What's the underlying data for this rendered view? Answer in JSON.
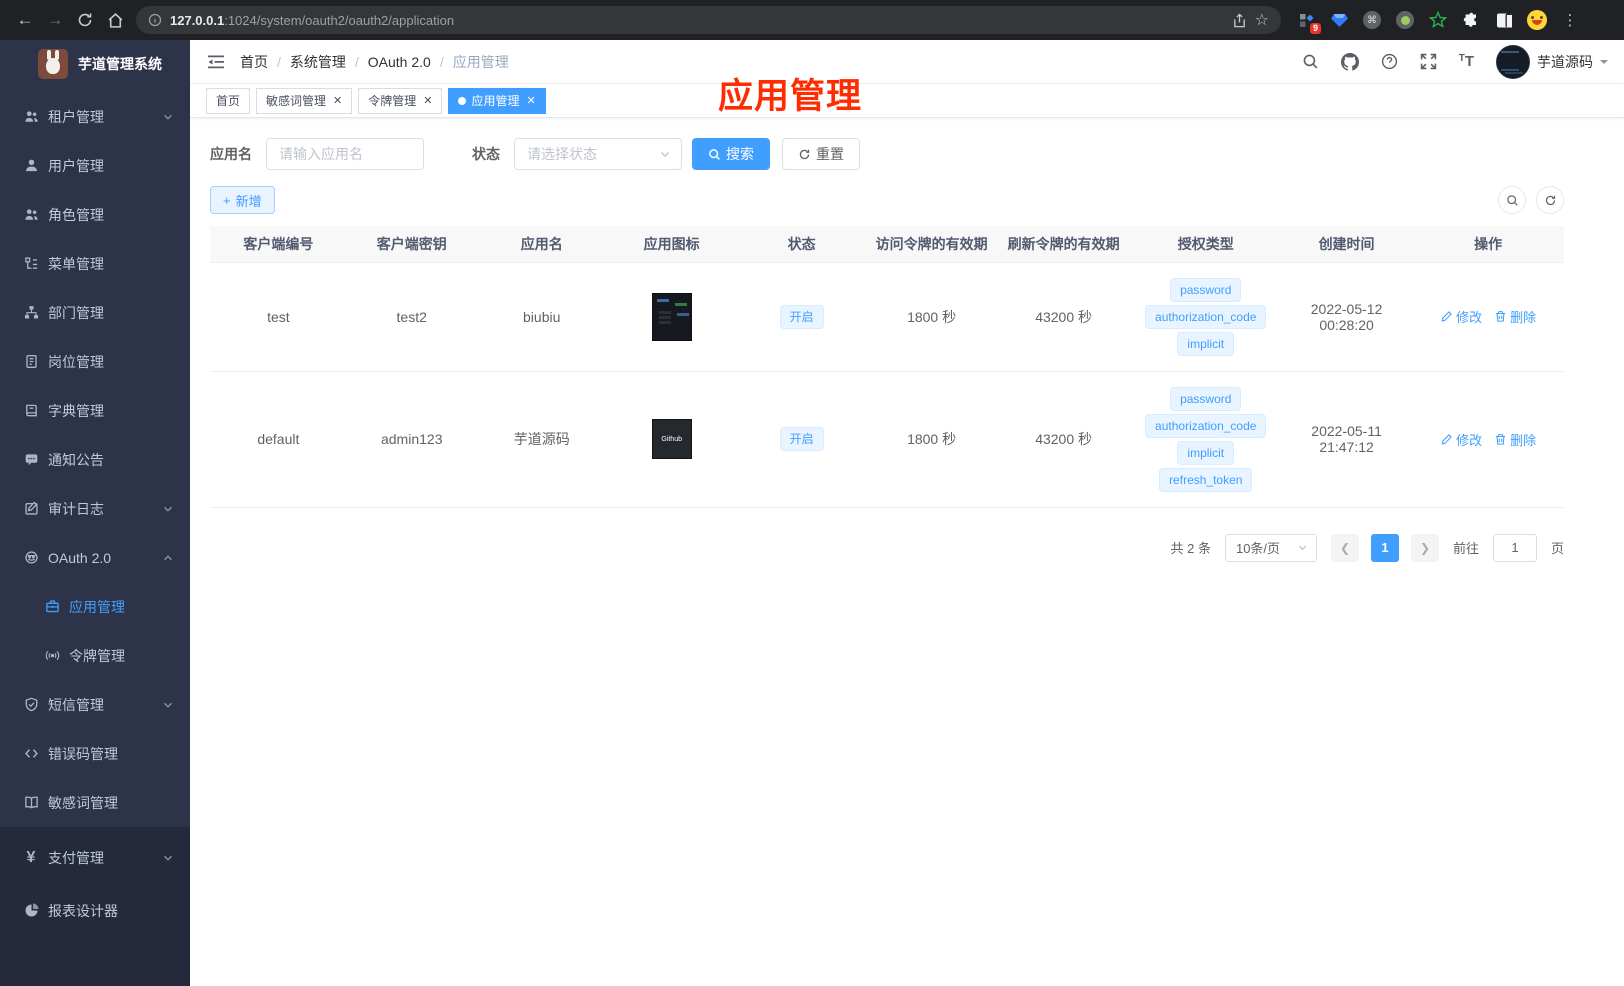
{
  "browser": {
    "url": {
      "host": "127.0.0.1",
      "rest": ":1024/system/oauth2/oauth2/application"
    },
    "ext_badge": "9"
  },
  "sidebar": {
    "app_title": "芋道管理系统",
    "menu": [
      {
        "label": "租户管理",
        "icon": "tenant",
        "arrow": "down"
      },
      {
        "label": "用户管理",
        "icon": "user"
      },
      {
        "label": "角色管理",
        "icon": "role"
      },
      {
        "label": "菜单管理",
        "icon": "menu"
      },
      {
        "label": "部门管理",
        "icon": "dept"
      },
      {
        "label": "岗位管理",
        "icon": "post"
      },
      {
        "label": "字典管理",
        "icon": "dict"
      },
      {
        "label": "通知公告",
        "icon": "notice"
      },
      {
        "label": "审计日志",
        "icon": "log",
        "arrow": "down"
      },
      {
        "label": "OAuth 2.0",
        "icon": "oauth",
        "arrow": "up",
        "children": [
          {
            "label": "应用管理",
            "icon": "app",
            "active": true
          },
          {
            "label": "令牌管理",
            "icon": "token"
          }
        ]
      },
      {
        "label": "短信管理",
        "icon": "sms",
        "arrow": "down"
      },
      {
        "label": "错误码管理",
        "icon": "errcode"
      },
      {
        "label": "敏感词管理",
        "icon": "sensitive"
      }
    ],
    "bottom_menu": [
      {
        "label": "支付管理",
        "icon": "pay",
        "arrow": "down"
      },
      {
        "label": "报表设计器",
        "icon": "report"
      }
    ]
  },
  "navbar": {
    "breadcrumb": [
      "首页",
      "系统管理",
      "OAuth 2.0",
      "应用管理"
    ],
    "username": "芋道源码"
  },
  "annotation": {
    "text": "应用管理",
    "color": "#fe2c00"
  },
  "tags_view": [
    {
      "label": "首页",
      "closable": false,
      "active": false
    },
    {
      "label": "敏感词管理",
      "closable": true,
      "active": false
    },
    {
      "label": "令牌管理",
      "closable": true,
      "active": false
    },
    {
      "label": "应用管理",
      "closable": true,
      "active": true
    }
  ],
  "filter": {
    "name_label": "应用名",
    "name_placeholder": "请输入应用名",
    "status_label": "状态",
    "status_placeholder": "请选择状态",
    "search_label": "搜索",
    "reset_label": "重置"
  },
  "toolbar": {
    "add_label": "新增"
  },
  "table": {
    "columns": [
      "客户端编号",
      "客户端密钥",
      "应用名",
      "应用图标",
      "状态",
      "访问令牌的有效期",
      "刷新令牌的有效期",
      "授权类型",
      "创建时间",
      "操作"
    ],
    "col_widths": [
      "10.1%",
      "9.6%",
      "9.6%",
      "9.6%",
      "9.6%",
      "9.6%",
      "9.9%",
      "11.1%",
      "9.7%",
      "11.2%"
    ],
    "actions": {
      "edit": "修改",
      "delete": "删除"
    },
    "rows": [
      {
        "client_id": "test",
        "secret": "test2",
        "name": "biubiu",
        "icon": "screenshot-thumb",
        "icon_text": "",
        "status": "开启",
        "access_ttl": "1800 秒",
        "refresh_ttl": "43200 秒",
        "grants": [
          "password",
          "authorization_code",
          "implicit"
        ],
        "created": "2022-05-12 00:28:20"
      },
      {
        "client_id": "default",
        "secret": "admin123",
        "name": "芋道源码",
        "icon": "github-thumb",
        "icon_text": "Github",
        "status": "开启",
        "access_ttl": "1800 秒",
        "refresh_ttl": "43200 秒",
        "grants": [
          "password",
          "authorization_code",
          "implicit",
          "refresh_token"
        ],
        "created": "2022-05-11 21:47:12"
      }
    ]
  },
  "pagination": {
    "total": "共 2 条",
    "page_size": "10条/页",
    "current_page": "1",
    "goto_label": "前往",
    "goto_value": "1",
    "page_label": "页"
  },
  "colors": {
    "primary": "#409eff",
    "sidebar_bg": "#2d3348",
    "annotation": "#fe2c00"
  }
}
